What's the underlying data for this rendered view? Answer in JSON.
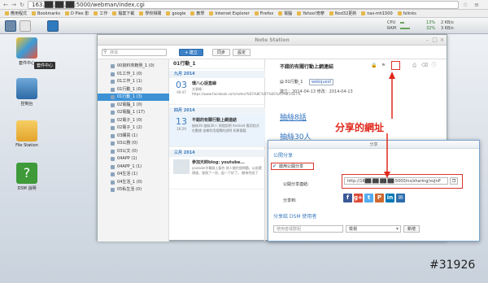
{
  "browser": {
    "url": "163.██.██.██:5000/webman/index.cgi",
    "bookmarks": [
      "應用程式",
      "Bookmarks",
      "D Plex 影",
      "工作",
      "檔案下載",
      "學校相關",
      "google",
      "教學",
      "Internet Explorer",
      "Firefox",
      "電腦",
      "Yahoo!奇摩",
      "Nod32更新",
      "nas-mh1500",
      "fxlinks"
    ]
  },
  "dsm": {
    "sysinfo": {
      "cpu_label": "CPU",
      "ram_label": "RAM",
      "cpu_pct": "13%",
      "ram_pct": "32%",
      "up": "2 KB/s",
      "down": "3 KB/s"
    },
    "desktop_icons": [
      {
        "label": "套件中心"
      },
      {
        "label": "控制台"
      },
      {
        "label": "File Station"
      },
      {
        "label": "DSM 說明"
      }
    ],
    "tooltip": "套件中心"
  },
  "notestation": {
    "title": "Note Station",
    "search_placeholder": "搜尋",
    "new_label": "+ 建立",
    "sync_label": "同步",
    "settings_label": "設定",
    "notebooks": [
      {
        "label": "00資料夾範例_1 (0)"
      },
      {
        "label": "01工作_1 (0)"
      },
      {
        "label": "01工作_1 (1)"
      },
      {
        "label": "01行動_1 (0)"
      },
      {
        "label": "01行動_1 (3)"
      },
      {
        "label": "02電腦_1 (0)"
      },
      {
        "label": "02電腦_1 (17)"
      },
      {
        "label": "02電子_1 (0)"
      },
      {
        "label": "02電子_1 (2)"
      },
      {
        "label": "03購買 (1)"
      },
      {
        "label": "03公務 (0)"
      },
      {
        "label": "03公文 (0)"
      },
      {
        "label": "04APP (1)"
      },
      {
        "label": "04APP_1 (1)"
      },
      {
        "label": "04生活 (1)"
      },
      {
        "label": "04生活_1 (0)"
      },
      {
        "label": "05私生活 (0)"
      }
    ],
    "selected_notebook": 4,
    "list_header": "01行動_1",
    "months": [
      "九月 2014",
      "四月 2014",
      "三月 2014"
    ],
    "notes": [
      {
        "day": "03",
        "time": "00:47",
        "title": "環八心捉直線",
        "text": "文張格：https://www.facebook.com/notes/%E5%8C%97%E6%A5%B5%E7%"
      },
      {
        "day": "13",
        "time": "16:29",
        "title": "不錯的有關行動上網連結",
        "text": "抽絲30 抽絲30人 例理說明 Android 應用程式在數據 這樣利用相關的說明 如果電腦"
      },
      {
        "day": "",
        "time": "",
        "title": "參加天帥blog: youtube...",
        "text": "youtube字幕錄上製作 其人間住個問題，以前還傳達，發現了一些，起一下好了。 開來完成了"
      }
    ],
    "note": {
      "title": "不錯的有關行動上網連結",
      "notebook": "01行動_1",
      "tag": "webquest",
      "meta": "建立：2014-04-13  修改：2014-04-13",
      "links": [
        "抽絲8話",
        "抽絲30人"
      ]
    }
  },
  "share": {
    "header": "分享",
    "section1": "公開分享",
    "public_label": "啟用公開分享",
    "link_label": "公開分享連結:",
    "social_label": "分享到:",
    "url": "http://16██.██.██.██:5000/ns/sharing/xvJnP",
    "section2": "分享給 DSM 使用者",
    "user_placeholder": "使用者或群組",
    "permission": "檢視",
    "add_label": "新增",
    "social": [
      {
        "name": "facebook-icon",
        "glyph": "f",
        "color": "#3b5998"
      },
      {
        "name": "google-plus-icon",
        "glyph": "g+",
        "color": "#dd4b39"
      },
      {
        "name": "twitter-icon",
        "glyph": "t",
        "color": "#55acee"
      },
      {
        "name": "plurk-icon",
        "glyph": "P",
        "color": "#cf682f"
      },
      {
        "name": "linkedin-icon",
        "glyph": "in",
        "color": "#0077b5"
      },
      {
        "name": "email-icon",
        "glyph": "✉",
        "color": "#2d6dad"
      }
    ]
  },
  "annotation": {
    "callout": "分享的網址",
    "watermark": "#31926",
    "color": "#e0281c"
  }
}
